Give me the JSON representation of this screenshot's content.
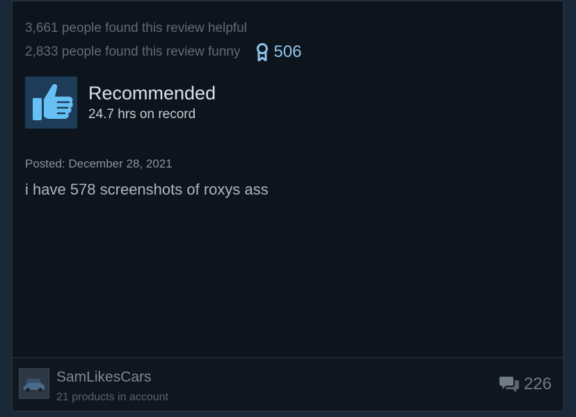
{
  "votes": {
    "helpful": "3,661 people found this review helpful",
    "funny": "2,833 people found this review funny",
    "awards_count": "506"
  },
  "recommendation": {
    "title": "Recommended",
    "hours": "24.7 hrs on record"
  },
  "review": {
    "posted": "Posted: December 28, 2021",
    "body": "i have 578 screenshots of roxys ass"
  },
  "author": {
    "name": "SamLikesCars",
    "products": "21 products in account"
  },
  "comments": {
    "count": "226"
  },
  "colors": {
    "card_bg": "#0e141b",
    "award_blue": "#8fc4ee",
    "thumb_bg": "#1d3c58",
    "thumb_icon": "#66c0f4"
  },
  "icons": [
    "award-ribbon-icon",
    "thumbs-up-icon",
    "comment-bubbles-icon"
  ]
}
